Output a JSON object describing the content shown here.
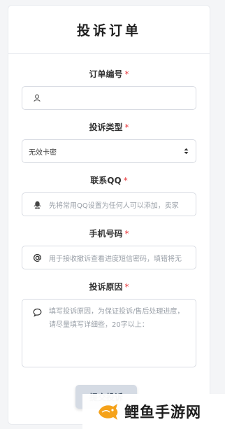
{
  "page": {
    "title": "投诉订单"
  },
  "form": {
    "order_no": {
      "label": "订单编号",
      "required": "*",
      "placeholder": ""
    },
    "complaint_type": {
      "label": "投诉类型",
      "required": "*",
      "value": "无效卡密"
    },
    "contact_qq": {
      "label": "联系QQ",
      "required": "*",
      "placeholder": "先将常用QQ设置为任何人可以添加，卖家"
    },
    "phone": {
      "label": "手机号码",
      "required": "*",
      "placeholder": "用于接收撤诉查看进度短信密码，填错将无"
    },
    "reason": {
      "label": "投诉原因",
      "required": "*",
      "placeholder": "填写投诉原因，为保证投诉/售后处理进度，请尽量填写详细些，20字以上："
    },
    "submit_label": "提交投诉"
  },
  "watermark": {
    "text": "鲤鱼手游网",
    "accent": "#f5a21a"
  },
  "icons": {
    "order_no": "user-icon",
    "contact_qq": "qq-icon",
    "phone": "at-icon",
    "reason": "comment-icon"
  }
}
